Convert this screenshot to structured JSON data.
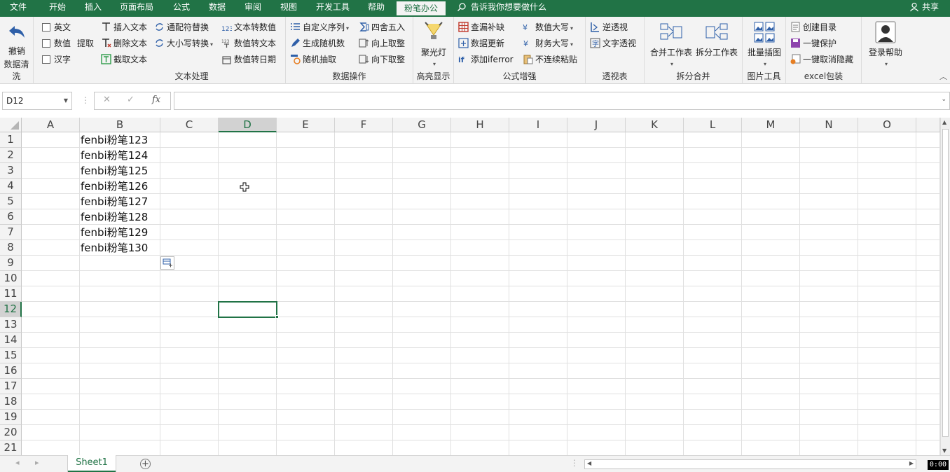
{
  "tabs": [
    "文件",
    "开始",
    "插入",
    "页面布局",
    "公式",
    "数据",
    "审阅",
    "视图",
    "开发工具",
    "帮助",
    "粉笔办公"
  ],
  "tell_me": "告诉我你想要做什么",
  "share": "共享",
  "ribbon": {
    "undo": "撤销",
    "cb_english": "英文",
    "cb_number": "数值",
    "cb_chinese": "汉字",
    "extract": "提取",
    "group_clean": "数据清洗",
    "insert_text": "插入文本",
    "delete_text": "删除文本",
    "cut_text": "截取文本",
    "wildcard_replace": "通配符替换",
    "case_convert": "大小写转换",
    "text_to_number": "文本转数值",
    "number_to_text": "数值转文本",
    "number_to_date": "数值转日期",
    "group_text": "文本处理",
    "custom_seq": "自定义序列",
    "gen_random": "生成随机数",
    "random_pick": "随机抽取",
    "round": "四舍五入",
    "round_up": "向上取整",
    "round_down": "向下取整",
    "group_data": "数据操作",
    "spotlight": "聚光灯",
    "group_highlight": "高亮显示",
    "check_missing": "查漏补缺",
    "data_update": "数据更新",
    "add_iferror": "添加iferror",
    "num_upper": "数值大写",
    "finance_upper": "财务大写",
    "discontinuous_paste": "不连续粘贴",
    "group_formula": "公式增强",
    "reverse_pivot": "逆透视",
    "text_pivot": "文字透视",
    "group_pivot": "透视表",
    "merge_sheets": "合并工作表",
    "split_sheets": "拆分工作表",
    "group_merge": "拆分合并",
    "batch_images": "批量插图",
    "group_image": "图片工具",
    "create_toc": "创建目录",
    "one_protect": "一键保护",
    "one_unhide": "一键取消隐藏",
    "group_excel": "excel包装",
    "login_help": "登录帮助"
  },
  "formula_bar": {
    "name_box": "D12",
    "fx": "fx",
    "content": ""
  },
  "columns": [
    "A",
    "B",
    "C",
    "D",
    "E",
    "F",
    "G",
    "H",
    "I",
    "J",
    "K",
    "L",
    "M",
    "N",
    "O"
  ],
  "rows": [
    "1",
    "2",
    "3",
    "4",
    "5",
    "6",
    "7",
    "8",
    "9",
    "10",
    "11",
    "12",
    "13",
    "14",
    "15",
    "16",
    "17",
    "18",
    "19",
    "20",
    "21"
  ],
  "cells_b": [
    "fenbi粉笔123",
    "fenbi粉笔124",
    "fenbi粉笔125",
    "fenbi粉笔126",
    "fenbi粉笔127",
    "fenbi粉笔128",
    "fenbi粉笔129",
    "fenbi粉笔130"
  ],
  "sheet_tab": "Sheet1",
  "timer": "0:00"
}
